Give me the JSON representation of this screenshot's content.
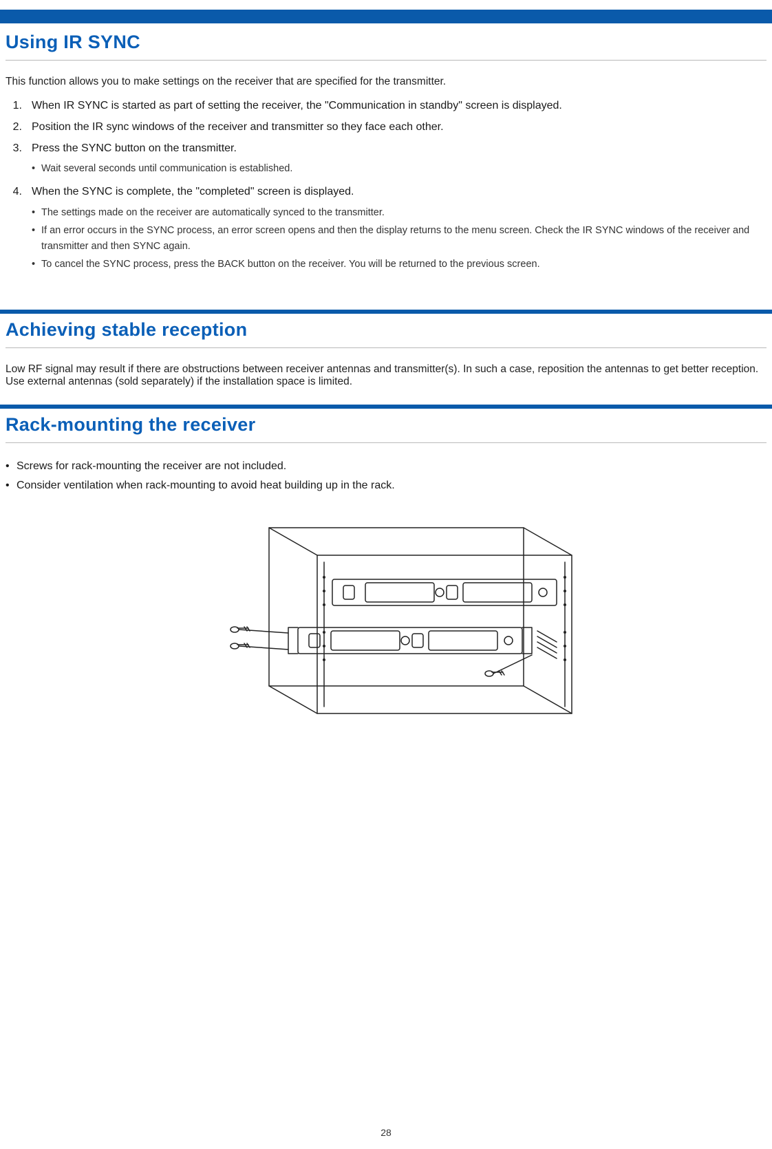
{
  "page_number": "28",
  "sections": {
    "ir_sync": {
      "title": "Using IR SYNC",
      "lead": "This function allows you to make settings on the receiver that are specified for the transmitter.",
      "steps": [
        {
          "num": "1.",
          "text": "When IR SYNC is started as part of setting the receiver, the \"Communication in standby\" screen is displayed.",
          "sub": []
        },
        {
          "num": "2.",
          "text": "Position the IR sync windows of the receiver and transmitter so they face each other.",
          "sub": []
        },
        {
          "num": "3.",
          "text": "Press the SYNC button on the transmitter.",
          "sub": [
            "Wait several seconds until communication is established."
          ]
        },
        {
          "num": "4.",
          "text": "When the SYNC is complete, the \"completed\" screen is displayed.",
          "sub": [
            "The settings made on the receiver are automatically synced to the transmitter.",
            "If an error occurs in the SYNC process, an error screen opens and then the display returns to the menu screen. Check the IR SYNC windows of the receiver and transmitter and then SYNC again.",
            "To cancel the SYNC process, press the BACK button on the receiver. You will be returned to the previous screen."
          ]
        }
      ]
    },
    "reception": {
      "title": "Achieving stable reception",
      "body": "Low RF signal may result if there are obstructions between receiver antennas and transmitter(s). In such a case, reposition the antennas to get better reception. Use external antennas (sold separately) if the installation space is limited."
    },
    "rack": {
      "title": "Rack-mounting the receiver",
      "bullets": [
        "Screws for rack-mounting the receiver are not included.",
        "Consider ventilation when rack-mounting to avoid heat building up in the rack."
      ]
    }
  }
}
